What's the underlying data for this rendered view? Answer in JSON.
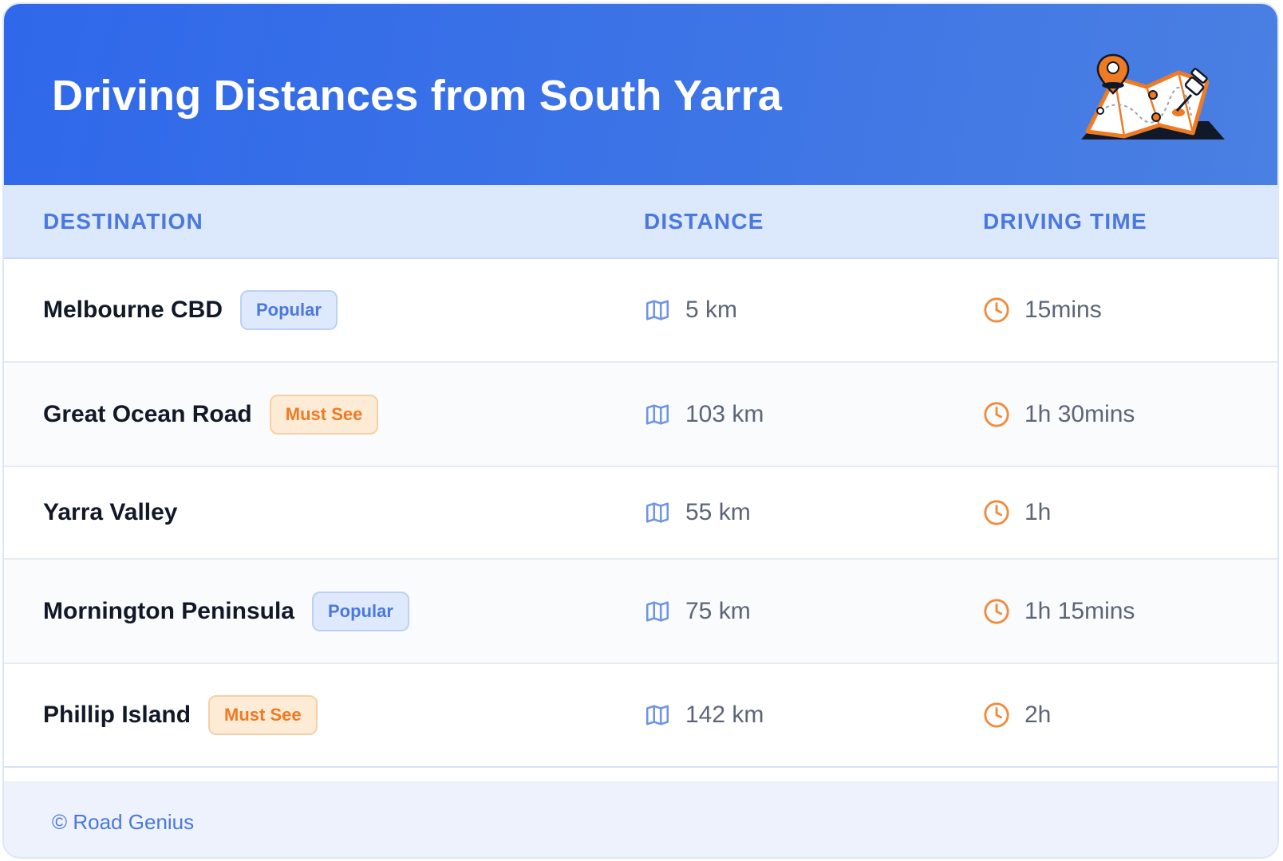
{
  "header": {
    "title": "Driving Distances from South Yarra",
    "illustration_icon": "map-with-pins-icon"
  },
  "columns": {
    "destination": "DESTINATION",
    "distance": "DISTANCE",
    "driving_time": "DRIVING TIME"
  },
  "rows": [
    {
      "destination": "Melbourne CBD",
      "badge": "Popular",
      "badge_type": "popular",
      "distance": "5 km",
      "time": "15mins"
    },
    {
      "destination": "Great Ocean Road",
      "badge": "Must See",
      "badge_type": "mustsee",
      "distance": "103 km",
      "time": "1h 30mins"
    },
    {
      "destination": "Yarra Valley",
      "badge": "",
      "badge_type": "",
      "distance": "55 km",
      "time": "1h"
    },
    {
      "destination": "Mornington Peninsula",
      "badge": "Popular",
      "badge_type": "popular",
      "distance": "75 km",
      "time": "1h 15mins"
    },
    {
      "destination": "Phillip Island",
      "badge": "Must See",
      "badge_type": "mustsee",
      "distance": "142 km",
      "time": "2h"
    }
  ],
  "icons": {
    "distance": "map-icon",
    "time": "clock-icon"
  },
  "colors": {
    "primary_blue": "#2f68ea",
    "badge_popular_text": "#4a78de",
    "badge_must_see_text": "#ef7a24",
    "clock_orange": "#f08a3c",
    "map_blue": "#6e95e6"
  },
  "footer": {
    "copyright": "© Road Genius"
  }
}
